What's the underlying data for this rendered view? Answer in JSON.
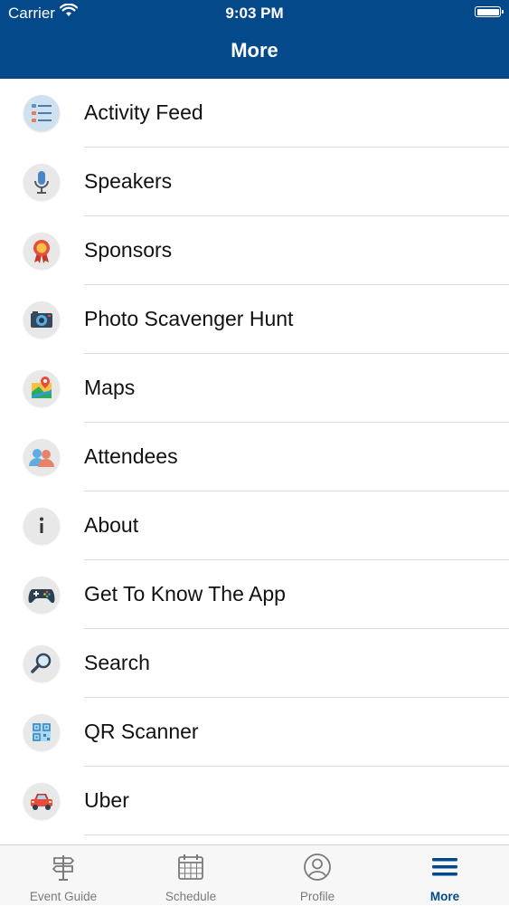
{
  "status_bar": {
    "carrier": "Carrier",
    "time": "9:03 PM"
  },
  "header": {
    "title": "More",
    "background": "#04498a"
  },
  "menu": {
    "items": [
      {
        "label": "Activity Feed",
        "icon": "activity-feed-icon"
      },
      {
        "label": "Speakers",
        "icon": "microphone-icon"
      },
      {
        "label": "Sponsors",
        "icon": "award-ribbon-icon"
      },
      {
        "label": "Photo Scavenger Hunt",
        "icon": "camera-icon"
      },
      {
        "label": "Maps",
        "icon": "map-pin-icon"
      },
      {
        "label": "Attendees",
        "icon": "people-icon"
      },
      {
        "label": "About",
        "icon": "info-icon"
      },
      {
        "label": "Get To Know The App",
        "icon": "gamepad-icon"
      },
      {
        "label": "Search",
        "icon": "magnifier-icon"
      },
      {
        "label": "QR Scanner",
        "icon": "qr-code-icon"
      },
      {
        "label": "Uber",
        "icon": "car-icon"
      }
    ]
  },
  "tab_bar": {
    "tabs": [
      {
        "label": "Event Guide",
        "icon": "signpost-icon",
        "active": false
      },
      {
        "label": "Schedule",
        "icon": "calendar-icon",
        "active": false
      },
      {
        "label": "Profile",
        "icon": "user-circle-icon",
        "active": false
      },
      {
        "label": "More",
        "icon": "hamburger-menu-icon",
        "active": true
      }
    ],
    "active_color": "#04498a",
    "inactive_color": "#7a7a7a"
  }
}
